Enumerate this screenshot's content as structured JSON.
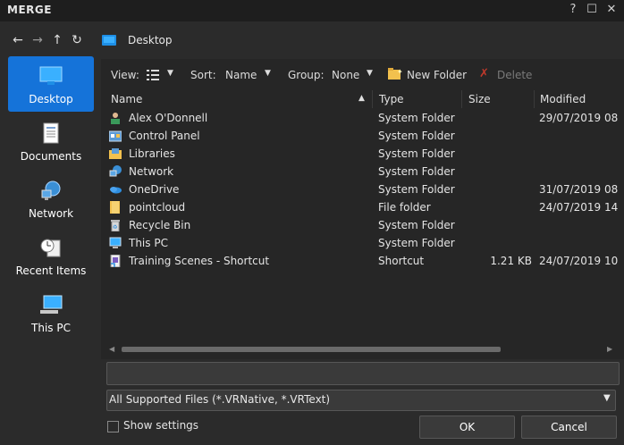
{
  "window": {
    "title": "MERGE",
    "help": "?",
    "maximize": "☐",
    "close": "✕"
  },
  "nav": {
    "back": "←",
    "forward": "→",
    "up": "↑",
    "refresh": "↻",
    "location": "Desktop"
  },
  "sidebar": {
    "items": [
      {
        "label": "Desktop",
        "icon": "desktop-icon",
        "active": true
      },
      {
        "label": "Documents",
        "icon": "documents-icon"
      },
      {
        "label": "Network",
        "icon": "network-icon"
      },
      {
        "label": "Recent Items",
        "icon": "recent-items-icon"
      },
      {
        "label": "This PC",
        "icon": "this-pc-icon"
      }
    ]
  },
  "toolbar": {
    "view_label": "View:",
    "sort_label": "Sort:",
    "sort_value": "Name",
    "group_label": "Group:",
    "group_value": "None",
    "new_folder": "New Folder",
    "delete": "Delete"
  },
  "columns": {
    "name": "Name",
    "type": "Type",
    "size": "Size",
    "modified": "Modified"
  },
  "files": [
    {
      "name": "Alex O'Donnell",
      "type": "System Folder",
      "size": "",
      "modified": "29/07/2019 08",
      "icon": "user-folder-icon"
    },
    {
      "name": "Control Panel",
      "type": "System Folder",
      "size": "",
      "modified": "",
      "icon": "control-panel-icon"
    },
    {
      "name": "Libraries",
      "type": "System Folder",
      "size": "",
      "modified": "",
      "icon": "libraries-icon"
    },
    {
      "name": "Network",
      "type": "System Folder",
      "size": "",
      "modified": "",
      "icon": "network-icon"
    },
    {
      "name": "OneDrive",
      "type": "System Folder",
      "size": "",
      "modified": "31/07/2019 08",
      "icon": "onedrive-icon"
    },
    {
      "name": "pointcloud",
      "type": "File folder",
      "size": "",
      "modified": "24/07/2019 14",
      "icon": "folder-icon"
    },
    {
      "name": "Recycle Bin",
      "type": "System Folder",
      "size": "",
      "modified": "",
      "icon": "recycle-bin-icon"
    },
    {
      "name": "This PC",
      "type": "System Folder",
      "size": "",
      "modified": "",
      "icon": "this-pc-icon"
    },
    {
      "name": "Training Scenes - Shortcut",
      "type": "Shortcut",
      "size": "1.21 KB",
      "modified": "24/07/2019 10",
      "icon": "shortcut-icon"
    }
  ],
  "filename": {
    "value": ""
  },
  "filter": {
    "value": "All Supported Files (*.VRNative, *.VRText)"
  },
  "show_settings": {
    "label": "Show settings",
    "checked": false
  },
  "buttons": {
    "ok": "OK",
    "cancel": "Cancel"
  },
  "colors": {
    "accent": "#1573d9",
    "background": "#2b2b2b",
    "panel": "#262626"
  }
}
